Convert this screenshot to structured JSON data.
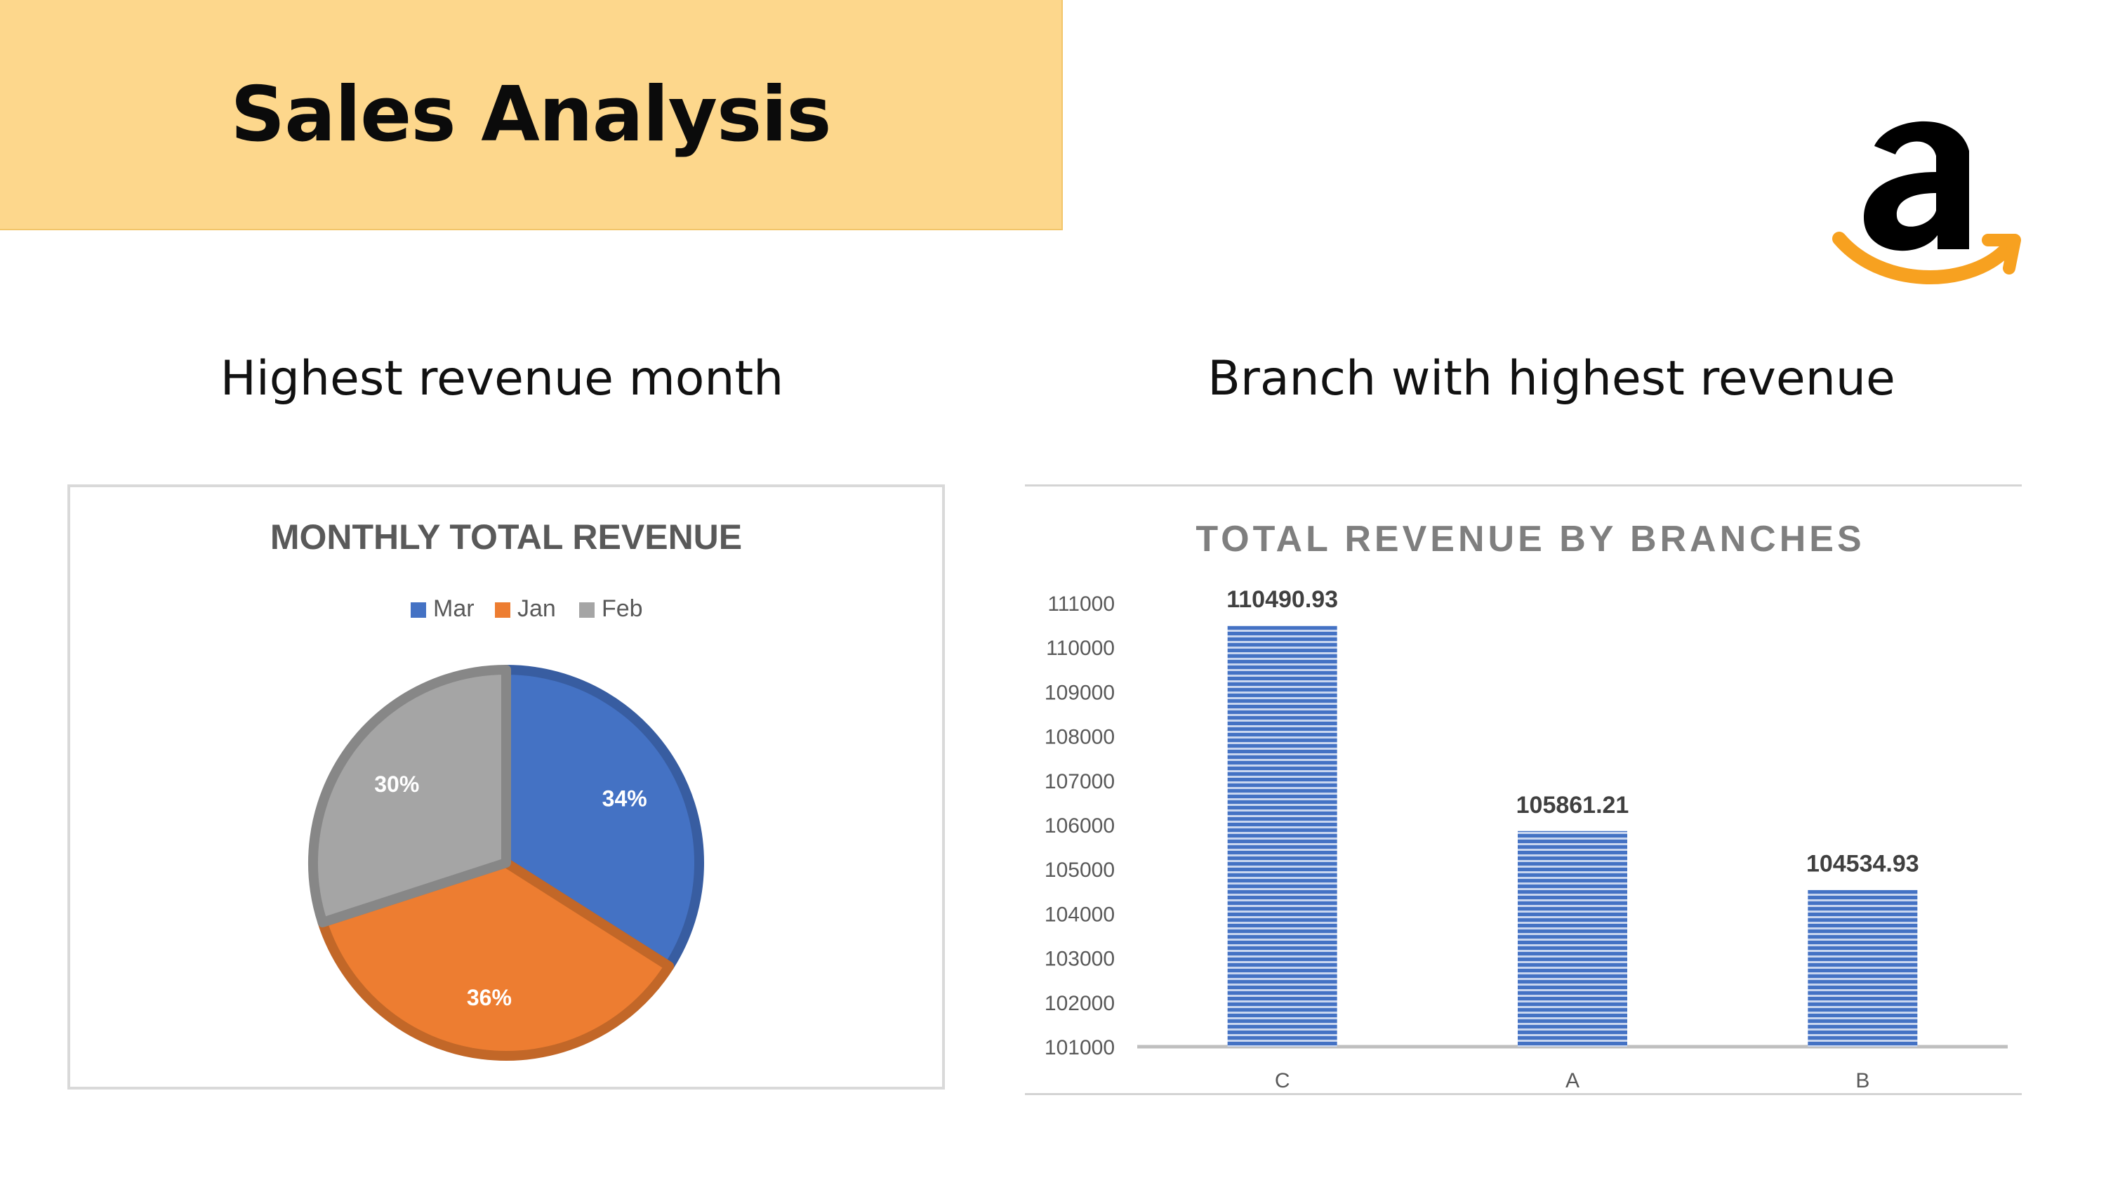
{
  "header": {
    "title": "Sales Analysis"
  },
  "logo": {
    "icon": "amazon-logo-icon",
    "text_color": "#000000",
    "smile_color": "#f7a120"
  },
  "sections": {
    "left_heading": "Highest revenue month",
    "right_heading": "Branch with highest revenue"
  },
  "chart_data": [
    {
      "type": "pie",
      "title": "MONTHLY TOTAL REVENUE",
      "legend_position": "top",
      "labels": [
        "Mar",
        "Jan",
        "Feb"
      ],
      "values": [
        34,
        36,
        30
      ],
      "value_labels": [
        "34%",
        "36%",
        "30%"
      ],
      "colors": [
        "#4472c4",
        "#ed7d31",
        "#a5a5a5"
      ]
    },
    {
      "type": "bar",
      "title": "TOTAL REVENUE BY BRANCHES",
      "categories": [
        "C",
        "A",
        "B"
      ],
      "values": [
        110490.93,
        105861.21,
        104534.93
      ],
      "value_labels": [
        "110490.93",
        "105861.21",
        "104534.93"
      ],
      "ylim": [
        101000,
        111000
      ],
      "yticks": [
        "101000",
        "102000",
        "103000",
        "104000",
        "105000",
        "106000",
        "107000",
        "108000",
        "109000",
        "110000",
        "111000"
      ],
      "bar_color": "#4472c4",
      "grid": false
    }
  ]
}
